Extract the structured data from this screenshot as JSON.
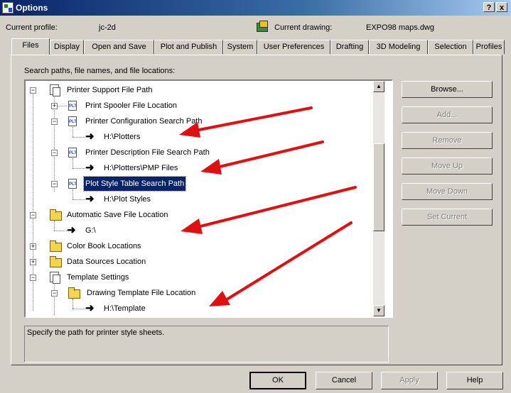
{
  "window": {
    "title": "Options",
    "help_btn": "?",
    "close_btn": "x"
  },
  "header": {
    "profile_label": "Current profile:",
    "profile_value": "jc-2d",
    "drawing_label": "Current drawing:",
    "drawing_value": "EXPO98 maps.dwg"
  },
  "tabs": [
    "Files",
    "Display",
    "Open and Save",
    "Plot and Publish",
    "System",
    "User Preferences",
    "Drafting",
    "3D Modeling",
    "Selection",
    "Profiles"
  ],
  "active_tab": "Files",
  "panel_label": "Search paths, file names, and file locations:",
  "tree": [
    {
      "label": "Printer Support File Path",
      "icon": "documents-icon",
      "expander": "−"
    },
    {
      "label": "Print Spooler File Location",
      "icon": "plotter-file-icon",
      "expander": "+"
    },
    {
      "label": "Printer Configuration Search Path",
      "icon": "plotter-file-icon",
      "expander": "−"
    },
    {
      "label": "H:\\Plotters",
      "icon": "path-arrow-icon"
    },
    {
      "label": "Printer Description File Search Path",
      "icon": "plotter-file-icon",
      "expander": "−"
    },
    {
      "label": "H:\\Plotters\\PMP Files",
      "icon": "path-arrow-icon"
    },
    {
      "label": "Plot Style Table Search Path",
      "icon": "plotter-file-icon",
      "expander": "−",
      "selected": true
    },
    {
      "label": "H:\\Plot Styles",
      "icon": "path-arrow-icon"
    },
    {
      "label": "Automatic Save File Location",
      "icon": "folder-icon",
      "expander": "−"
    },
    {
      "label": "G:\\",
      "icon": "path-arrow-icon"
    },
    {
      "label": "Color Book Locations",
      "icon": "folder-icon",
      "expander": "+"
    },
    {
      "label": "Data Sources Location",
      "icon": "folder-icon",
      "expander": "+"
    },
    {
      "label": "Template Settings",
      "icon": "documents-icon",
      "expander": "−"
    },
    {
      "label": "Drawing Template File Location",
      "icon": "folder-icon",
      "expander": "−"
    },
    {
      "label": "H:\\Template",
      "icon": "path-arrow-icon"
    }
  ],
  "side_buttons": [
    {
      "label": "Browse...",
      "enabled": true
    },
    {
      "label": "Add...",
      "enabled": false
    },
    {
      "label": "Remove",
      "enabled": false
    },
    {
      "label": "Move Up",
      "enabled": false
    },
    {
      "label": "Move Down",
      "enabled": false
    },
    {
      "label": "Set Current",
      "enabled": false
    }
  ],
  "description": "Specify the path for printer style sheets.",
  "footer_buttons": [
    {
      "label": "OK",
      "enabled": true,
      "default": true
    },
    {
      "label": "Cancel",
      "enabled": true
    },
    {
      "label": "Apply",
      "enabled": false
    },
    {
      "label": "Help",
      "enabled": true
    }
  ],
  "annotation_color": "#e01010"
}
